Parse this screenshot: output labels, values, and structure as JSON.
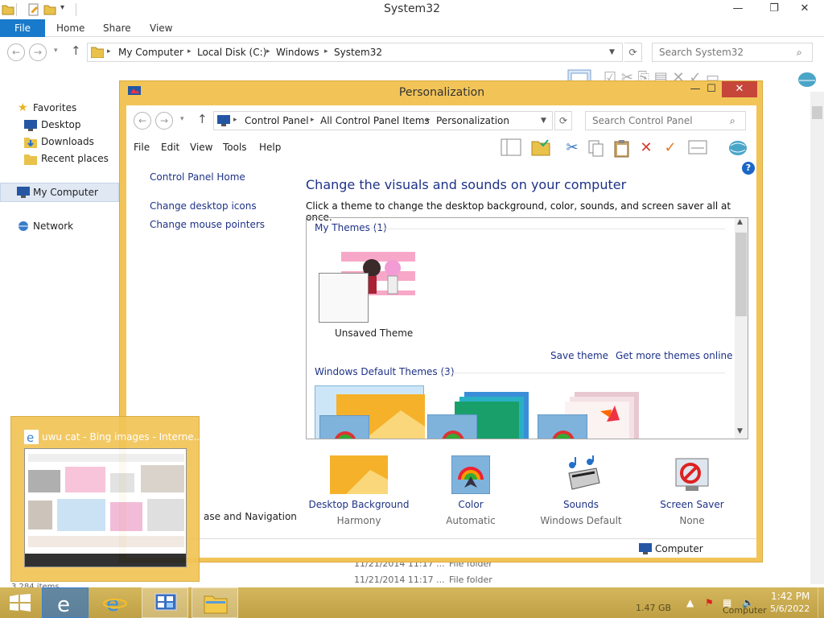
{
  "explorer": {
    "title": "System32",
    "window_controls": [
      "—",
      "❐",
      "✕"
    ],
    "ribbon": {
      "file": "File",
      "tabs": [
        "Home",
        "Share",
        "View"
      ]
    },
    "address": {
      "crumbs": [
        "My Computer",
        "Local Disk (C:)",
        "Windows",
        "System32"
      ]
    },
    "search_placeholder": "Search System32",
    "nav": {
      "favorites": "Favorites",
      "favorite_items": [
        "Desktop",
        "Downloads",
        "Recent places"
      ],
      "computer": "My Computer",
      "network": "Network"
    },
    "ghost_rows": [
      {
        "date": "11/21/2014 11:17 ...",
        "type": "File folder"
      },
      {
        "date": "11/21/2014 11:17 ...",
        "type": "File folder"
      }
    ],
    "status_items": "3,284 items"
  },
  "personalization": {
    "title": "Personalization",
    "window_controls": [
      "—",
      "☐",
      "✕"
    ],
    "address": {
      "crumbs": [
        "Control Panel",
        "All Control Panel Items",
        "Personalization"
      ]
    },
    "search_placeholder": "Search Control Panel",
    "menu": [
      "File",
      "Edit",
      "View",
      "Tools",
      "Help"
    ],
    "sidebar": {
      "home": "Control Panel Home",
      "links": [
        "Change desktop icons",
        "Change mouse pointers"
      ],
      "see_also_partial": "ase and Navigation"
    },
    "heading": "Change the visuals and sounds on your computer",
    "description": "Click a theme to change the desktop background, color, sounds, and screen saver all at once.",
    "my_themes_label": "My Themes (1)",
    "unsaved_theme": "Unsaved Theme",
    "save_theme": "Save theme",
    "get_more": "Get more themes online",
    "default_themes_label": "Windows Default Themes (3)",
    "bottom": [
      {
        "title": "Desktop Background",
        "sub": "Harmony"
      },
      {
        "title": "Color",
        "sub": "Automatic"
      },
      {
        "title": "Sounds",
        "sub": "Windows Default"
      },
      {
        "title": "Screen Saver",
        "sub": "None"
      }
    ],
    "status": "Computer"
  },
  "ie_preview": {
    "title": "uwu cat - Bing images - Interne..."
  },
  "taskbar": {
    "time": "1:42 PM",
    "date": "5/6/2022",
    "size_ghost": "1.47 GB",
    "computer_ghost": "Computer"
  },
  "colors": {
    "window_frame": "#f2c458",
    "taskbar": "#c9ab4e",
    "file_tab": "#1979ca",
    "link": "#1e3287"
  }
}
